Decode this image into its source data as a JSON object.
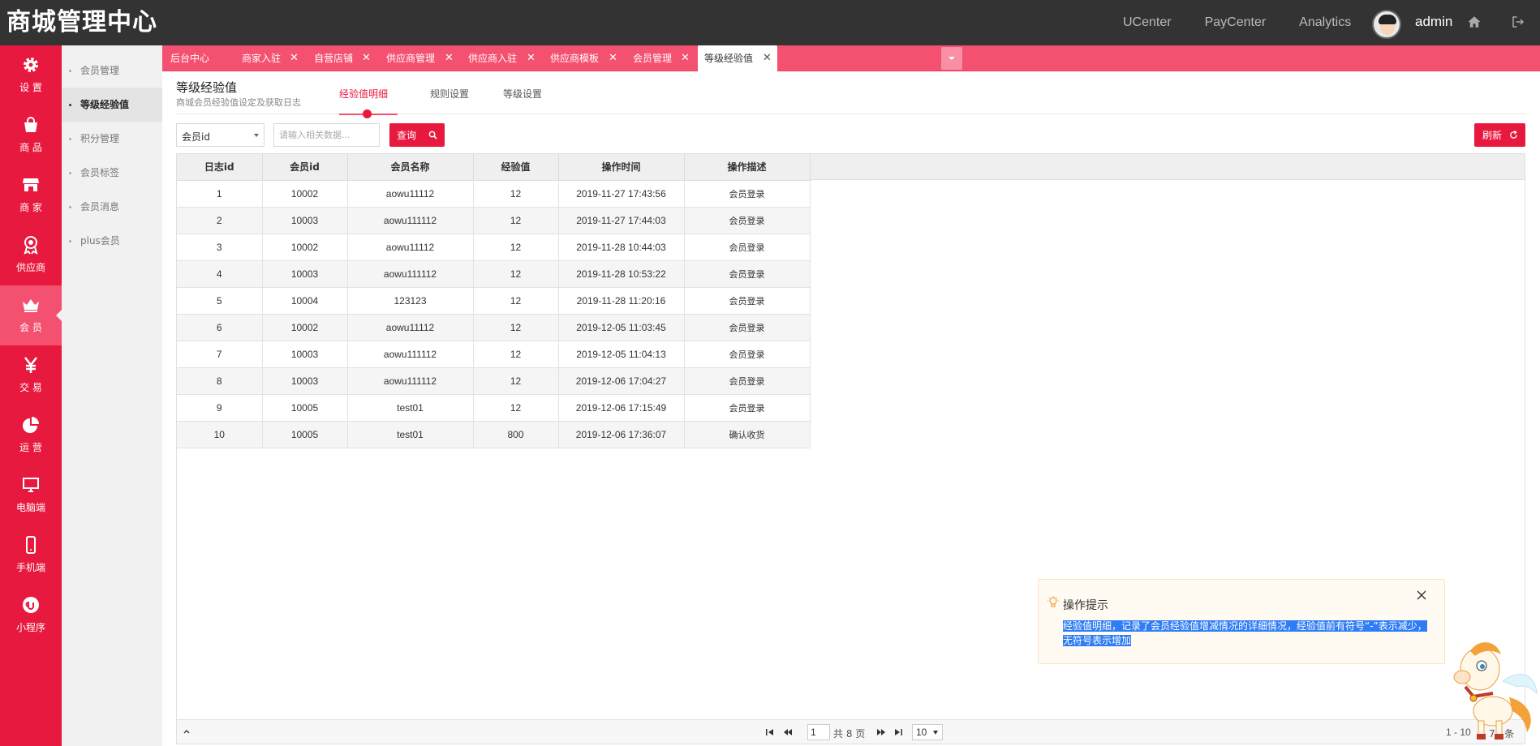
{
  "brand": "商城管理中心",
  "topnav": [
    "UCenter",
    "PayCenter",
    "Analytics"
  ],
  "user": {
    "name": "admin"
  },
  "sidebar": [
    {
      "label": "设 置",
      "icon": "gear-icon"
    },
    {
      "label": "商 品",
      "icon": "bag-icon"
    },
    {
      "label": "商 家",
      "icon": "store-icon"
    },
    {
      "label": "供应商",
      "icon": "badge-icon"
    },
    {
      "label": "会 员",
      "icon": "crown-icon",
      "active": true
    },
    {
      "label": "交 易",
      "icon": "yen-icon"
    },
    {
      "label": "运 营",
      "icon": "pie-icon"
    },
    {
      "label": "电脑端",
      "icon": "monitor-icon"
    },
    {
      "label": "手机端",
      "icon": "phone-icon"
    },
    {
      "label": "小程序",
      "icon": "miniapp-icon"
    }
  ],
  "submenu": [
    {
      "label": "会员管理"
    },
    {
      "label": "等级经验值",
      "active": true
    },
    {
      "label": "积分管理"
    },
    {
      "label": "会员标签"
    },
    {
      "label": "会员消息"
    },
    {
      "label": "plus会员"
    }
  ],
  "tabs": [
    {
      "label": "后台中心",
      "closable": false
    },
    {
      "label": "商家入驻",
      "closable": true
    },
    {
      "label": "自营店铺",
      "closable": true
    },
    {
      "label": "供应商管理",
      "closable": true
    },
    {
      "label": "供应商入驻",
      "closable": true
    },
    {
      "label": "供应商模板",
      "closable": true
    },
    {
      "label": "会员管理",
      "closable": true
    },
    {
      "label": "等级经验值",
      "closable": true,
      "active": true
    }
  ],
  "page": {
    "title": "等级经验值",
    "subtitle": "商城会员经验值设定及获取日志",
    "tabs": [
      "经验值明细",
      "规则设置",
      "等级设置"
    ]
  },
  "search": {
    "field": "会员id",
    "placeholder": "请输入相关数据...",
    "query_label": "查询",
    "refresh_label": "刷新"
  },
  "table": {
    "columns": [
      "日志id",
      "会员id",
      "会员名称",
      "经验值",
      "操作时间",
      "操作描述"
    ],
    "rows": [
      [
        "1",
        "10002",
        "aowu11112",
        "12",
        "2019-11-27 17:43:56",
        "会员登录"
      ],
      [
        "2",
        "10003",
        "aowu111112",
        "12",
        "2019-11-27 17:44:03",
        "会员登录"
      ],
      [
        "3",
        "10002",
        "aowu11112",
        "12",
        "2019-11-28 10:44:03",
        "会员登录"
      ],
      [
        "4",
        "10003",
        "aowu111112",
        "12",
        "2019-11-28 10:53:22",
        "会员登录"
      ],
      [
        "5",
        "10004",
        "123123",
        "12",
        "2019-11-28 11:20:16",
        "会员登录"
      ],
      [
        "6",
        "10002",
        "aowu11112",
        "12",
        "2019-12-05 11:03:45",
        "会员登录"
      ],
      [
        "7",
        "10003",
        "aowu111112",
        "12",
        "2019-12-05 11:04:13",
        "会员登录"
      ],
      [
        "8",
        "10003",
        "aowu111112",
        "12",
        "2019-12-06 17:04:27",
        "会员登录"
      ],
      [
        "9",
        "10005",
        "test01",
        "12",
        "2019-12-06 17:15:49",
        "会员登录"
      ],
      [
        "10",
        "10005",
        "test01",
        "800",
        "2019-12-06 17:36:07",
        "确认收货"
      ]
    ]
  },
  "pager": {
    "page": "1",
    "total_pages": "共 8 页",
    "page_size": "10",
    "range": "1 - 10",
    "count": "74 条"
  },
  "tip": {
    "title": "操作提示",
    "body": "经验值明细，记录了会员经验值增减情况的详细情况，经验值前有符号“-”表示减少，无符号表示增加"
  },
  "colors": {
    "accent": "#e8193e",
    "topbar": "#333333",
    "tabbar": "#f4506f"
  }
}
